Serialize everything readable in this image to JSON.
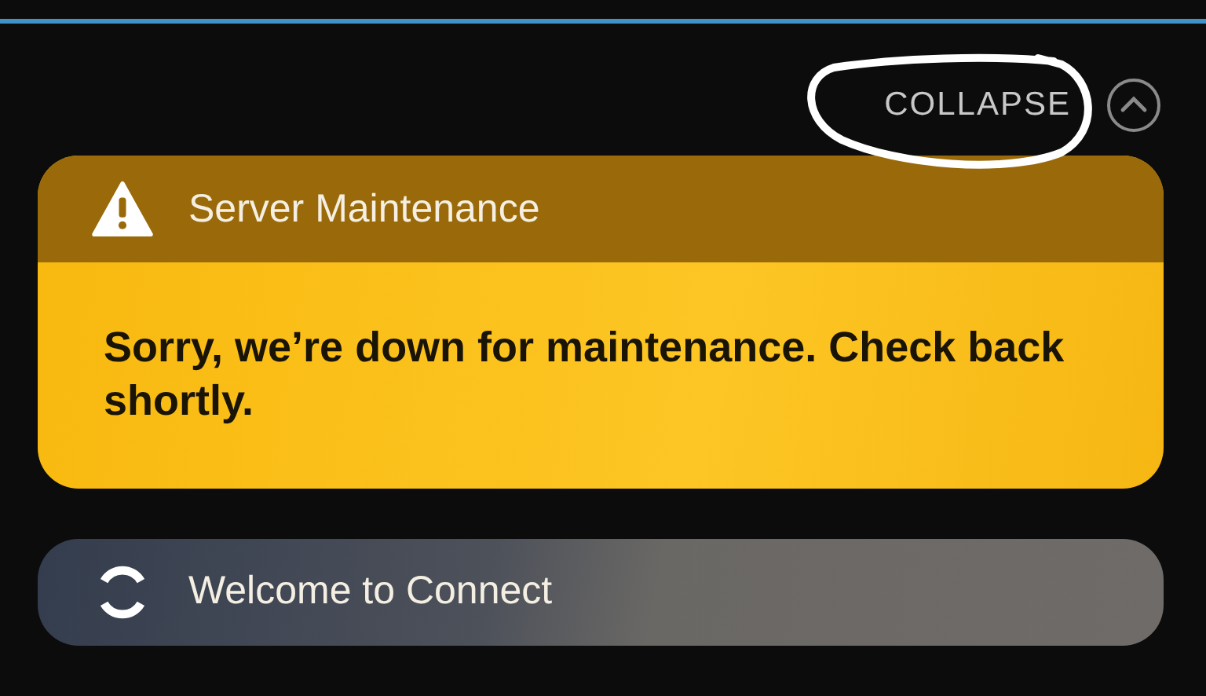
{
  "collapse_button": {
    "label": "COLLAPSE"
  },
  "notifications": [
    {
      "kind": "warning",
      "title": "Server Maintenance",
      "message": "Sorry, we’re down for maintenance. Check back shortly."
    },
    {
      "kind": "loading",
      "title": "Welcome to Connect"
    }
  ]
}
